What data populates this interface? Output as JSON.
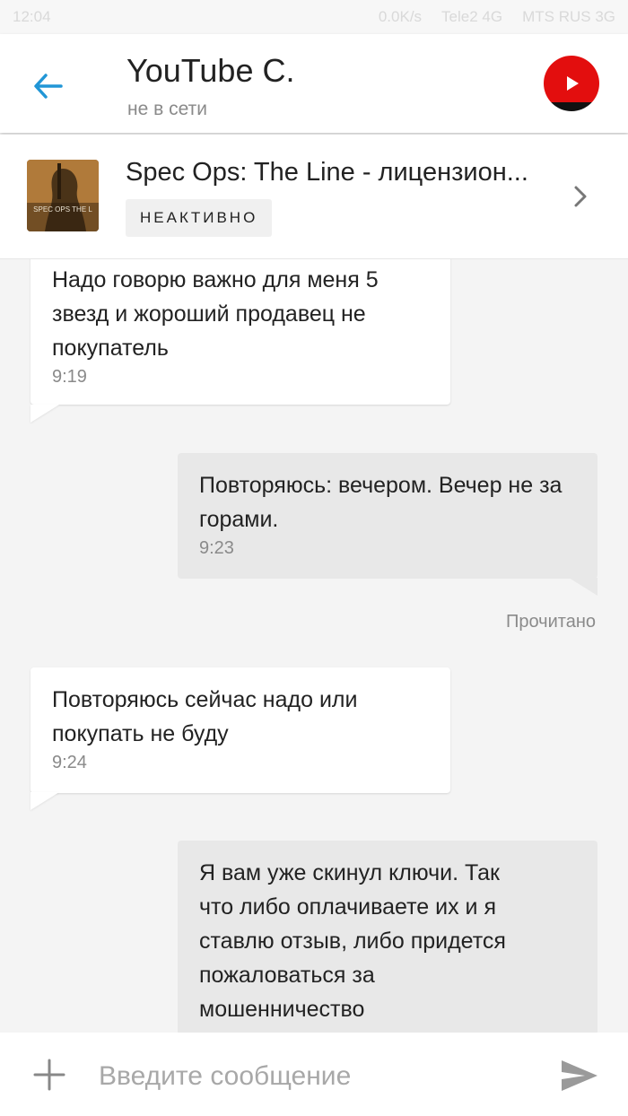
{
  "status_bar": {
    "time": "12:04",
    "network_speed": "0.0K/s",
    "carrier_1": "Tele2 4G",
    "carrier_2": "MTS RUS 3G"
  },
  "header": {
    "contact_name": "YouTube C.",
    "contact_status": "не в сети"
  },
  "product": {
    "title": "Spec Ops: The Line - лицензион...",
    "status": "НЕАКТИВНО",
    "thumb_text": "SPEC OPS THE L"
  },
  "messages": [
    {
      "direction": "in",
      "text": "Надо говорю важно для меня 5 звезд и жороший продавец не покупатель",
      "time": "9:19"
    },
    {
      "direction": "out",
      "text": "Повторяюсь: вечером. Вечер не за горами.",
      "time": "9:23",
      "receipt": "Прочитано"
    },
    {
      "direction": "in",
      "text": "Повторяюсь сейчас надо или покупать не буду",
      "time": "9:24"
    },
    {
      "direction": "out",
      "text": "Я вам уже скинул ключи. Так что либо оплачиваете их и я ставлю отзыв, либо придется пожаловаться за мошенничество",
      "time": ""
    }
  ],
  "composer": {
    "placeholder": "Введите сообщение"
  },
  "colors": {
    "accent": "#2196d6",
    "avatar_red": "#e30e0e"
  }
}
